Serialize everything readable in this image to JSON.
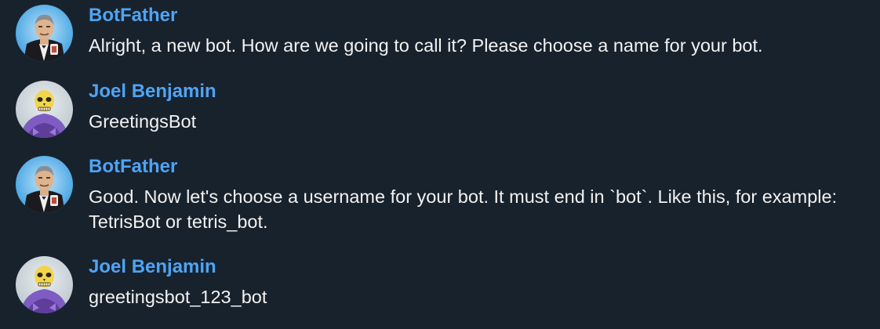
{
  "chat": {
    "messages": [
      {
        "sender": "BotFather",
        "avatar": "botfather-avatar",
        "text": "Alright, a new bot. How are we going to call it? Please choose a name for your bot."
      },
      {
        "sender": "Joel Benjamin",
        "avatar": "skeletor-avatar",
        "text": "GreetingsBot"
      },
      {
        "sender": "BotFather",
        "avatar": "botfather-avatar",
        "text": "Good. Now let's choose a username for your bot. It must end in `bot`. Like this, for example: TetrisBot or tetris_bot."
      },
      {
        "sender": "Joel Benjamin",
        "avatar": "skeletor-avatar",
        "text": "greetingsbot_123_bot"
      }
    ]
  },
  "colors": {
    "background": "#18222d",
    "sender_name": "#4ea4f5",
    "message_text": "#f2f2f2"
  }
}
